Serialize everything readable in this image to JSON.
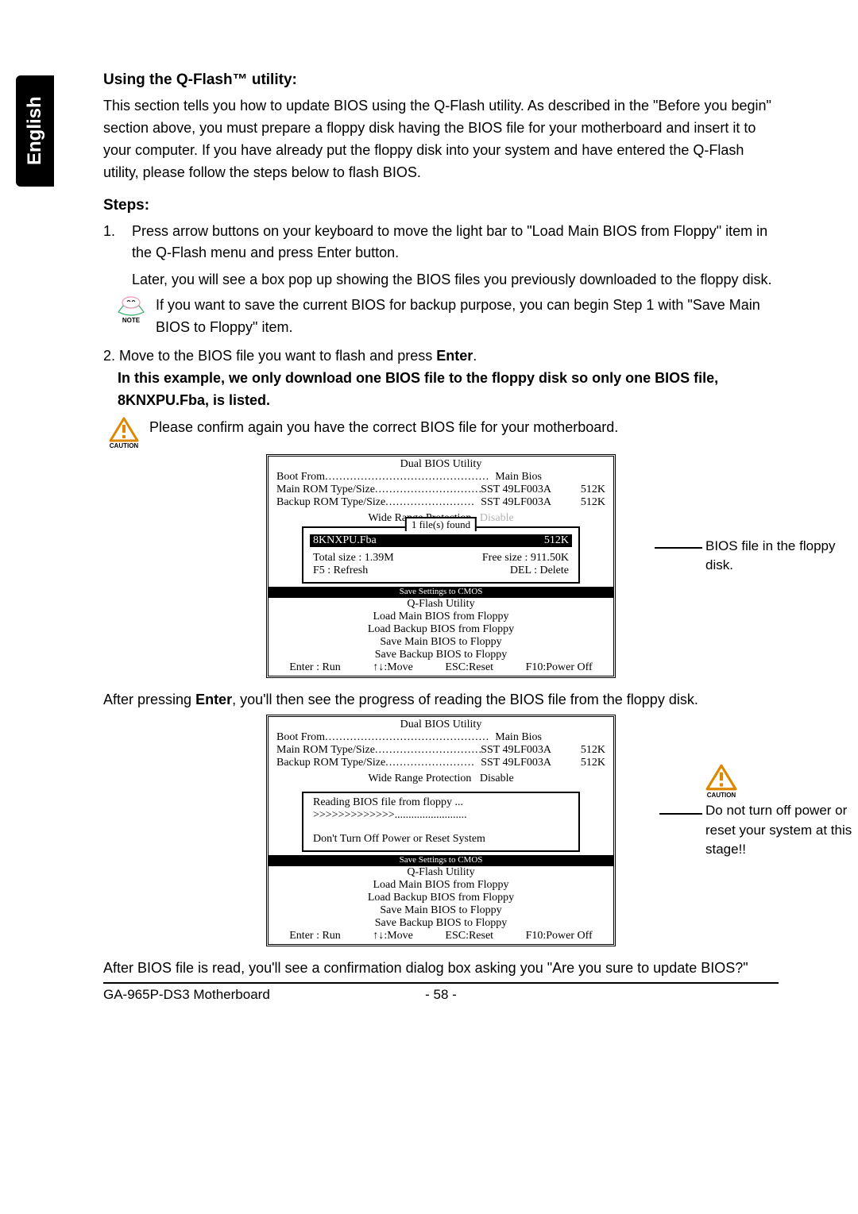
{
  "lang_tab": "English",
  "h_using": "Using the Q-Flash™ utility:",
  "p_using": "This section tells you how to update BIOS using the Q-Flash utility. As described in the \"Before you begin\" section above, you must prepare a floppy disk having the BIOS file for your motherboard and insert it to your computer. If you have already put the floppy disk into your system and have entered the Q-Flash utility, please follow the steps below to flash BIOS.",
  "h_steps": "Steps:",
  "step1_num": "1.",
  "step1_a": "Press arrow buttons on your keyboard to move the light bar to \"Load Main BIOS from Floppy\" item in the Q-Flash menu and press Enter button.",
  "step1_b": "Later, you will see a box pop up showing the BIOS files you previously downloaded to the floppy disk.",
  "note_label": "NOTE",
  "note_text": "If you want to save the current BIOS for backup purpose, you can begin Step 1 with \"Save Main BIOS to Floppy\" item.",
  "step2_pre": "2. Move to the BIOS file you want to flash and press ",
  "step2_enter": "Enter",
  "step2_post": ".",
  "step2_bold": "In this example, we only download one BIOS file to the floppy disk so only one BIOS file, 8KNXPU.Fba, is listed.",
  "caution_label": "CAUTION",
  "caution_text": "Please confirm again you have the correct BIOS file for your motherboard.",
  "bios": {
    "title": "Dual BIOS Utility",
    "boot_from_l": "Boot From",
    "boot_from_v": "Main Bios",
    "main_rom_l": "Main ROM Type/Size",
    "main_rom_v": "SST 49LF003A",
    "main_rom_s": "512K",
    "backup_rom_l": "Backup ROM Type/Size",
    "backup_rom_v": "SST 49LF003A",
    "backup_rom_s": "512K",
    "wide_range": "Wide Range Protection",
    "disable": "Disable",
    "files_found": "1 file(s) found",
    "file_name": "8KNXPU.Fba",
    "file_size": "512K",
    "total": "Total size : 1.39M",
    "free": "Free size :  911.50K",
    "f5": "F5 : Refresh",
    "del": "DEL : Delete",
    "reading": "Reading BIOS file from floppy ...",
    "progress": ">>>>>>>>>>>>>",
    "dont_turn": "Don't Turn Off Power or Reset System",
    "save_cmos": "Save Settings to CMOS",
    "qflash": "Q-Flash Utility",
    "menu1": "Load Main BIOS from Floppy",
    "menu2": "Load Backup BIOS from Floppy",
    "menu3": "Save Main BIOS to Floppy",
    "menu4": "Save Backup BIOS to Floppy",
    "k_enter": "Enter : Run",
    "k_move": "↑↓:Move",
    "k_esc": "ESC:Reset",
    "k_f10": "F10:Power Off"
  },
  "annot1": "BIOS file in the floppy disk.",
  "annot2": "Do not turn off power or reset your system at this stage!!",
  "after1a": "After pressing ",
  "after1b": "Enter",
  "after1c": ", you'll then see the progress of reading the BIOS file from the floppy disk.",
  "after2": "After BIOS file is read, you'll see a confirmation dialog box asking you \"Are you sure to update BIOS?\"",
  "footer_model": "GA-965P-DS3 Motherboard",
  "footer_page": "- 58 -"
}
